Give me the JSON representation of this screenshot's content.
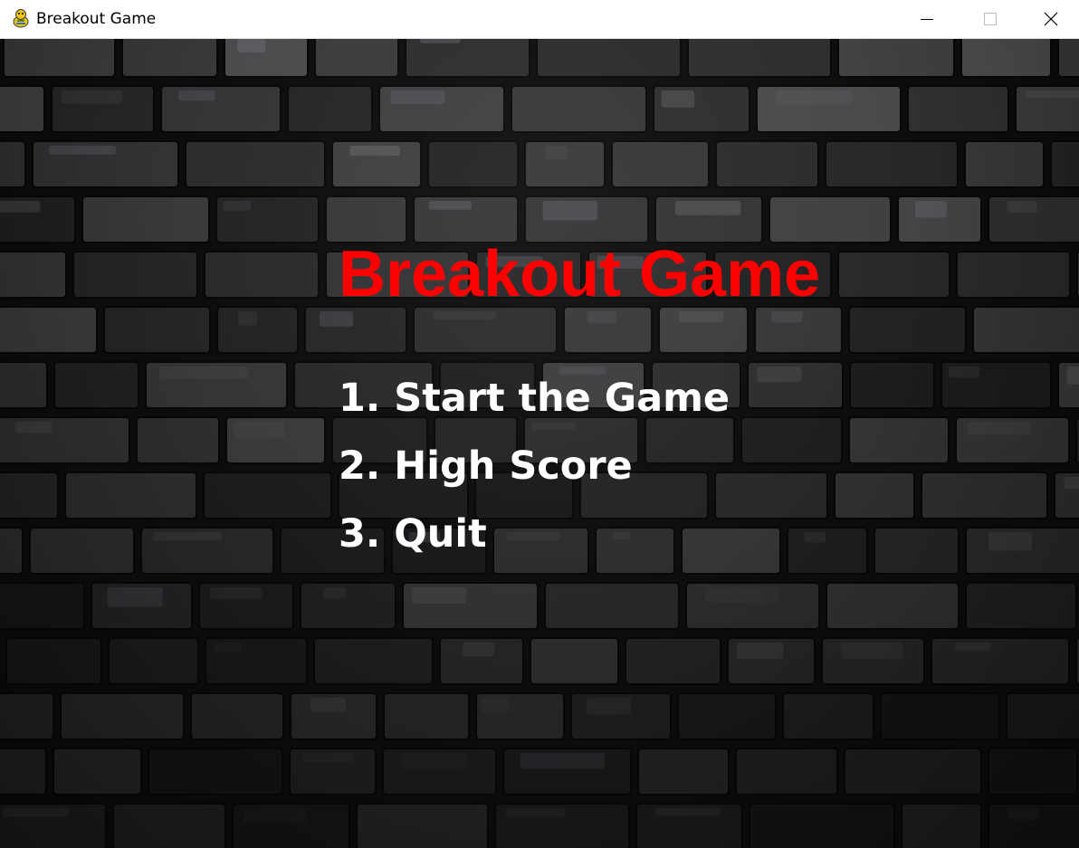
{
  "window": {
    "title": "Breakout Game",
    "app_icon": "pygame-snake-icon",
    "controls": {
      "minimize_icon": "minimize-icon",
      "maximize_icon": "maximize-icon",
      "close_icon": "close-icon"
    }
  },
  "game": {
    "background": "dark-stone-brick-wall",
    "title": "Breakout Game",
    "title_color": "#ff0000",
    "menu_color": "#ffffff",
    "menu": [
      {
        "label": "1. Start the Game"
      },
      {
        "label": "2. High Score"
      },
      {
        "label": "3. Quit"
      }
    ]
  }
}
